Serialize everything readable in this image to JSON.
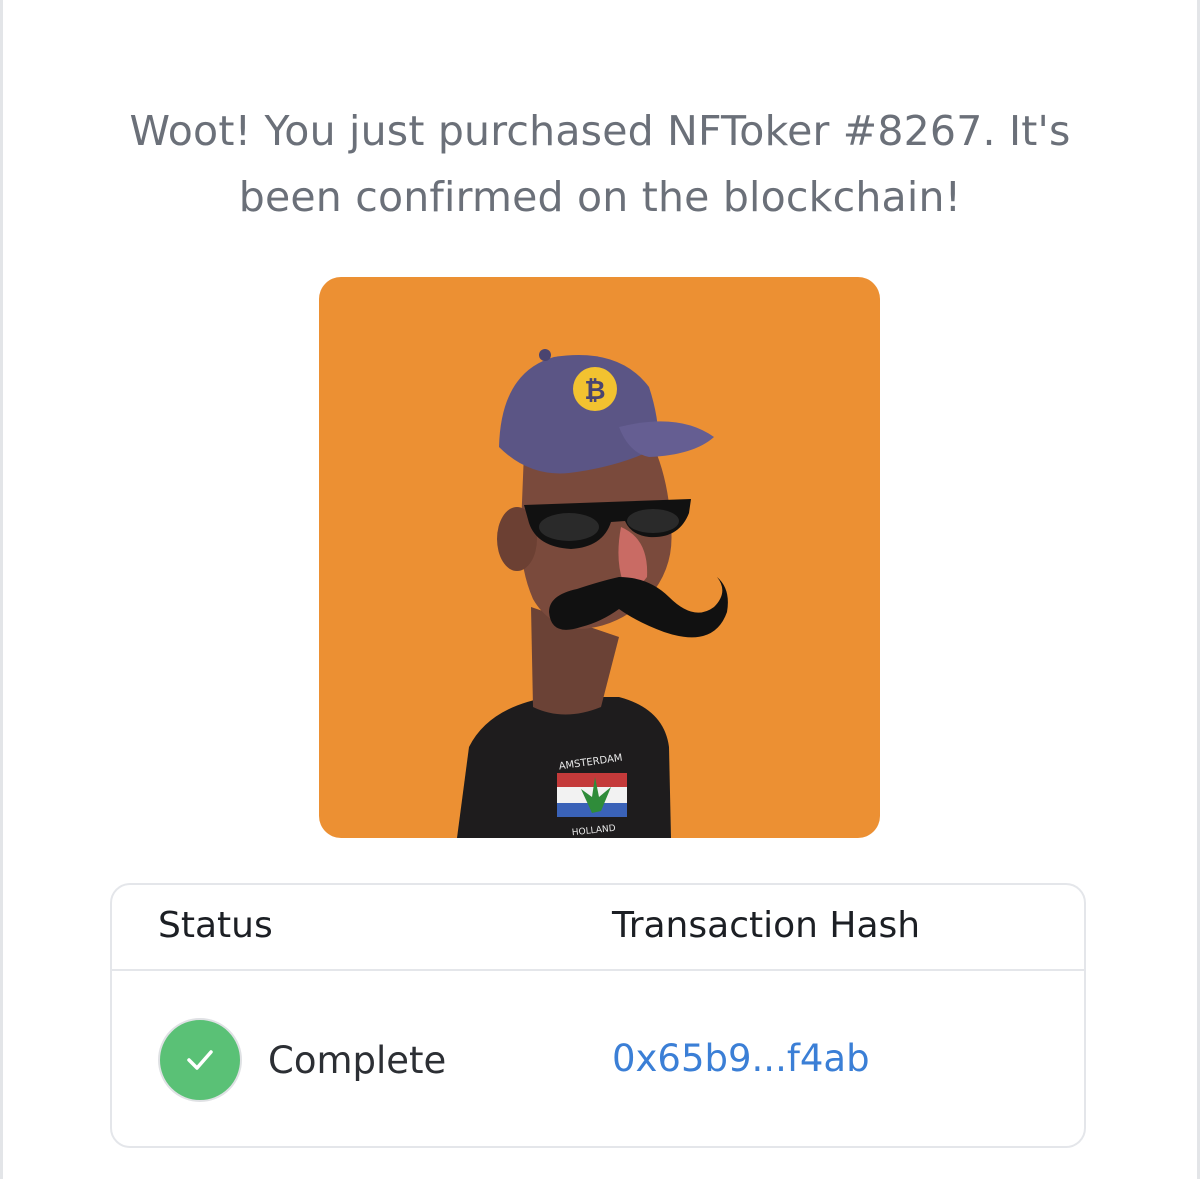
{
  "message": {
    "line1": "Woot! You just purchased NFToker #8267. It's",
    "line2": "been confirmed on the blockchain!"
  },
  "nft": {
    "background_color": "#ec9033",
    "shirt_text_top": "AMSTERDAM",
    "shirt_text_bottom": "HOLLAND"
  },
  "table": {
    "headers": {
      "status": "Status",
      "hash": "Transaction Hash"
    },
    "rows": [
      {
        "status": "Complete",
        "status_icon": "check-icon",
        "hash": "0x65b9...f4ab"
      }
    ]
  },
  "colors": {
    "success": "#5ac176",
    "link": "#3b7fd6",
    "muted_text": "#6b7079"
  }
}
